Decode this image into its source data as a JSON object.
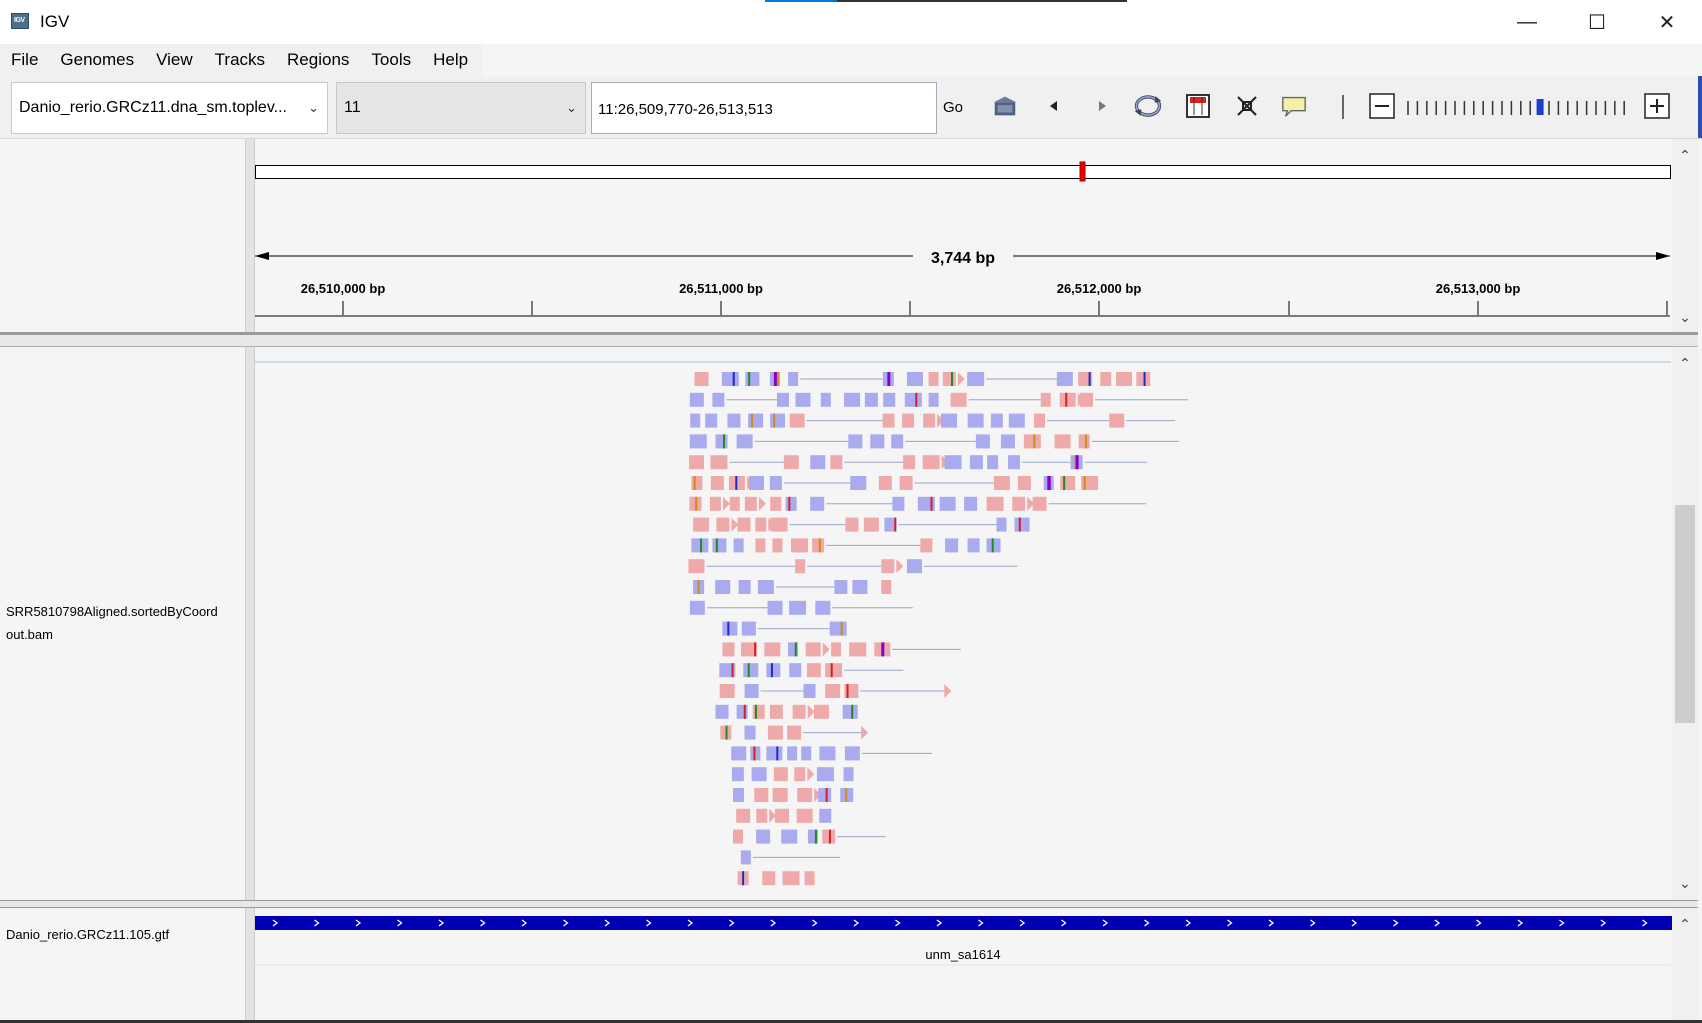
{
  "window": {
    "title": "IGV",
    "minimize": "—",
    "maximize": "☐",
    "close": "✕"
  },
  "menu": {
    "items": [
      "File",
      "Genomes",
      "View",
      "Tracks",
      "Regions",
      "Tools",
      "Help"
    ]
  },
  "toolbar": {
    "genome": "Danio_rerio.GRCz11.dna_sm.toplev...",
    "chromosome": "11",
    "locus": "11:26,509,770-26,513,513",
    "go_label": "Go",
    "zoom_level_fraction": 0.6
  },
  "ruler": {
    "span_label": "3,744 bp",
    "ticks": [
      "26,510,000 bp",
      "26,511,000 bp",
      "26,512,000 bp",
      "26,513,000 bp"
    ]
  },
  "tracks": {
    "alignment_name_line1": "SRR5810798Aligned.sortedByCoord",
    "alignment_name_line2": "out.bam",
    "annotation_name": "Danio_rerio.GRCz11.105.gtf",
    "feature_name": "unm_sa1614"
  },
  "colors": {
    "forward_read": "#eeaaaa",
    "reverse_read": "#aaaaee",
    "feature": "#0000b2",
    "insertion": "#8a00c8"
  }
}
